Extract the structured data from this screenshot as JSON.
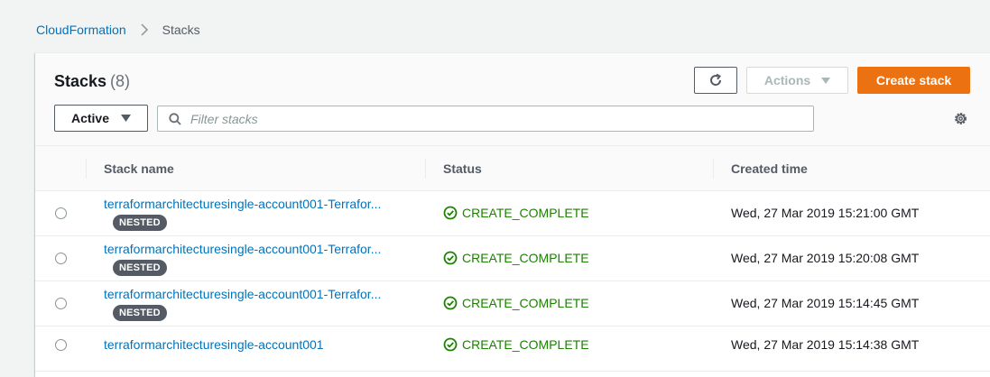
{
  "breadcrumb": {
    "parent": "CloudFormation",
    "current": "Stacks"
  },
  "panel": {
    "title": "Stacks",
    "count": "(8)",
    "actions_label": "Actions",
    "create_label": "Create stack",
    "filter_selected": "Active",
    "search_placeholder": "Filter stacks"
  },
  "table": {
    "columns": [
      "Stack name",
      "Status",
      "Created time"
    ],
    "rows": [
      {
        "name": "terraformarchitecturesingle-account001-Terrafor...",
        "badge": "NESTED",
        "status": "CREATE_COMPLETE",
        "created": "Wed, 27 Mar 2019 15:21:00 GMT"
      },
      {
        "name": "terraformarchitecturesingle-account001-Terrafor...",
        "badge": "NESTED",
        "status": "CREATE_COMPLETE",
        "created": "Wed, 27 Mar 2019 15:20:08 GMT"
      },
      {
        "name": "terraformarchitecturesingle-account001-Terrafor...",
        "badge": "NESTED",
        "status": "CREATE_COMPLETE",
        "created": "Wed, 27 Mar 2019 15:14:45 GMT"
      },
      {
        "name": "terraformarchitecturesingle-account001",
        "badge": "",
        "status": "CREATE_COMPLETE",
        "created": "Wed, 27 Mar 2019 15:14:38 GMT"
      }
    ]
  },
  "colors": {
    "link": "#0073bb",
    "primary_button": "#ec7211",
    "success": "#1d8102",
    "badge": "#545b64"
  },
  "icons": {
    "breadcrumb_separator": "chevron-right-icon",
    "refresh": "refresh-icon",
    "dropdown": "caret-down-icon",
    "search": "search-icon",
    "settings": "gear-icon",
    "status": "check-circle-icon"
  }
}
